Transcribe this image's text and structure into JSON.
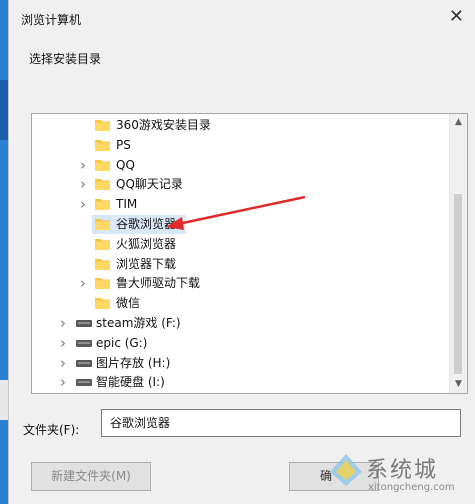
{
  "dialog": {
    "title": "浏览计算机",
    "prompt": "选择安装目录",
    "close_glyph": "✕"
  },
  "tree": {
    "items": [
      {
        "label": "360游戏安装目录",
        "type": "folder",
        "expandable": false
      },
      {
        "label": "PS",
        "type": "folder",
        "expandable": false
      },
      {
        "label": "QQ",
        "type": "folder",
        "expandable": true
      },
      {
        "label": "QQ聊天记录",
        "type": "folder",
        "expandable": true
      },
      {
        "label": "TIM",
        "type": "folder",
        "expandable": true
      },
      {
        "label": "谷歌浏览器",
        "type": "folder",
        "expandable": false,
        "selected": true
      },
      {
        "label": "火狐浏览器",
        "type": "folder",
        "expandable": false
      },
      {
        "label": "浏览器下载",
        "type": "folder",
        "expandable": false
      },
      {
        "label": "鲁大师驱动下载",
        "type": "folder",
        "expandable": true
      },
      {
        "label": "微信",
        "type": "folder",
        "expandable": false
      },
      {
        "label": "steam游戏 (F:)",
        "type": "drive",
        "expandable": true
      },
      {
        "label": "epic (G:)",
        "type": "drive",
        "expandable": true
      },
      {
        "label": "图片存放 (H:)",
        "type": "drive",
        "expandable": true
      },
      {
        "label": "智能硬盘 (I:)",
        "type": "drive",
        "expandable": true
      }
    ]
  },
  "folder_field": {
    "label": "文件夹(F):",
    "value": "谷歌浏览器"
  },
  "buttons": {
    "new_folder": "新建文件夹(M)",
    "ok_partial": "确"
  },
  "watermark": {
    "brand": "系统城",
    "url": "xitongcheng.com"
  },
  "colors": {
    "folder": "#f5c542",
    "selection": "#d9e8f9",
    "arrow": "#e02a2a",
    "desktop": "#2d7fd1"
  },
  "icons": {
    "expand": "chevron-right-icon",
    "folder": "folder-icon",
    "drive": "drive-icon",
    "close": "close-icon"
  }
}
